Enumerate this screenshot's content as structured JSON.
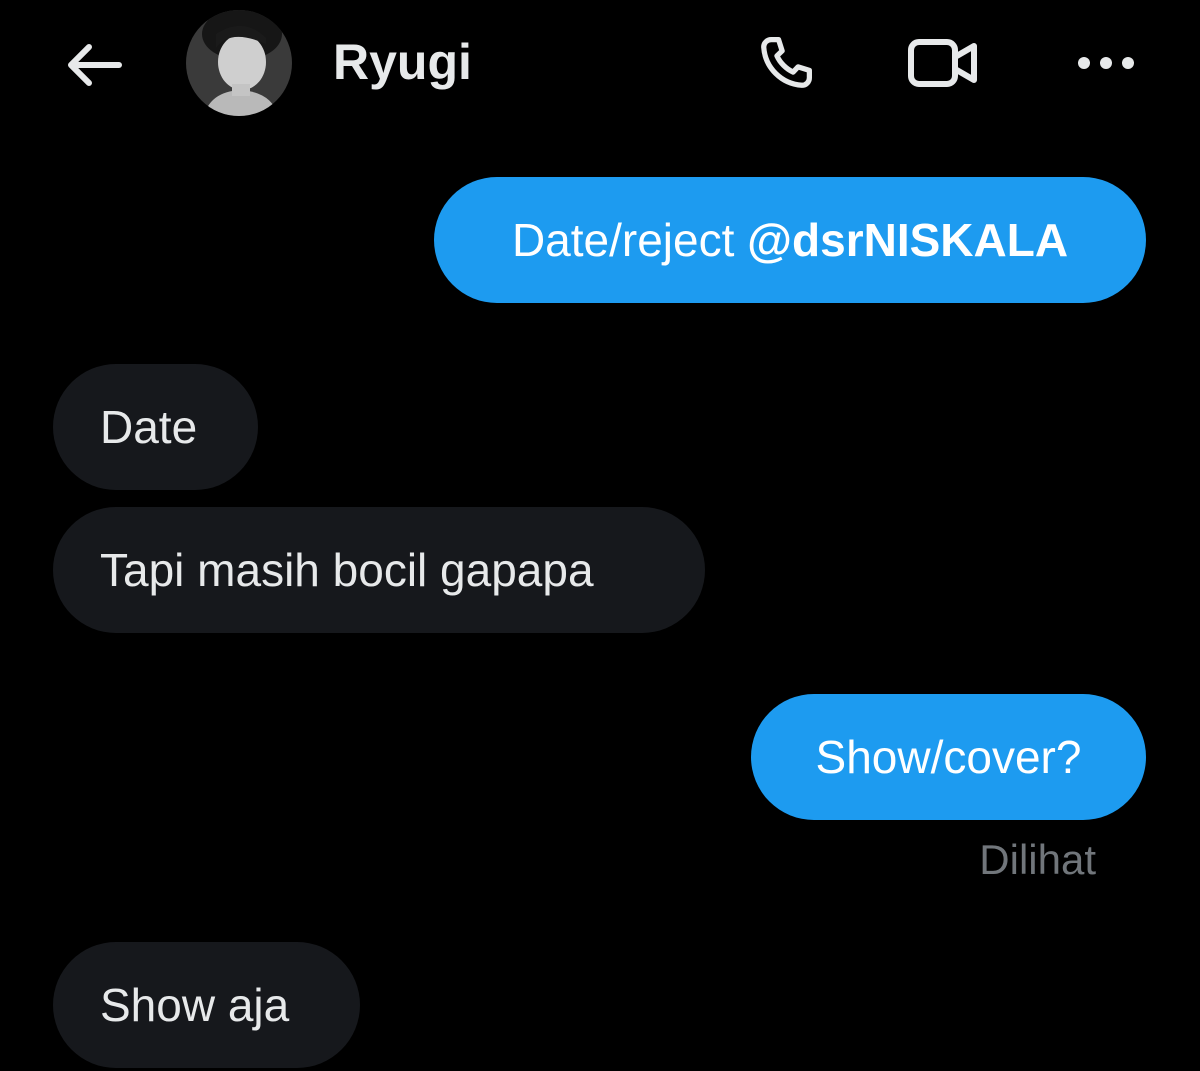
{
  "header": {
    "back_icon": "arrow-left-icon",
    "contact_name": "Ryugi",
    "actions": [
      "phone-icon",
      "video-camera-icon",
      "more-horizontal-icon"
    ]
  },
  "messages": [
    {
      "direction": "sent",
      "text": "Date/reject ",
      "mention": "@dsrNISKALA"
    },
    {
      "direction": "received",
      "text": "Date"
    },
    {
      "direction": "received",
      "text": "Tapi masih bocil gapapa"
    },
    {
      "direction": "sent",
      "text": "Show/cover?"
    },
    {
      "direction": "received",
      "text": "Show aja"
    }
  ],
  "read_status": "Dilihat",
  "colors": {
    "background": "#000000",
    "sent_bubble": "#1d9bf0",
    "received_bubble": "#16181c",
    "primary_text": "#e7e9ea",
    "secondary_text": "#71767b"
  }
}
